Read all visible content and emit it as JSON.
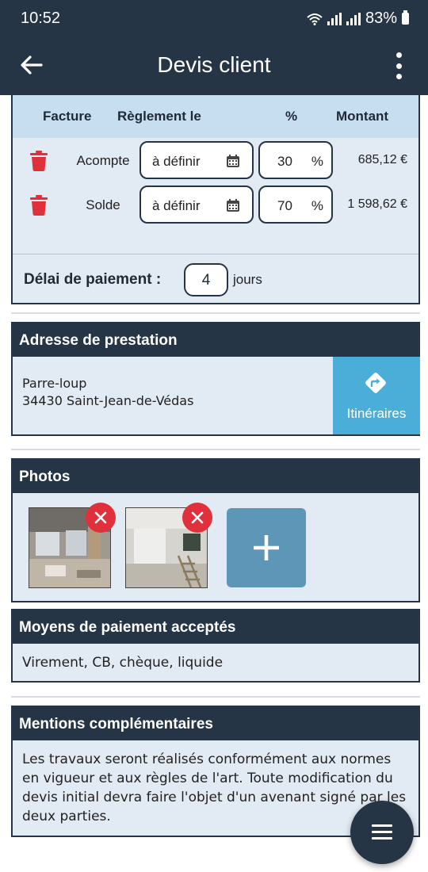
{
  "status_bar": {
    "time": "10:52",
    "battery": "83%"
  },
  "app_bar": {
    "title": "Devis client"
  },
  "payment_schedule": {
    "headers": {
      "invoice": "Facture",
      "settlement": "Règlement le",
      "percent": "%",
      "amount": "Montant"
    },
    "rows": [
      {
        "label": "Acompte",
        "date": "à définir",
        "percent": "30",
        "percent_sign": "%",
        "amount": "685,12 €"
      },
      {
        "label": "Solde",
        "date": "à définir",
        "percent": "70",
        "percent_sign": "%",
        "amount": "1 598,62 €"
      }
    ],
    "delay_label": "Délai de paiement :",
    "delay_value": "4",
    "delay_unit": "jours"
  },
  "address": {
    "title": "Adresse de prestation",
    "line1": "Parre-loup",
    "line2": "34430 Saint-Jean-de-Védas",
    "itinerary_label": "Itinéraires"
  },
  "photos": {
    "title": "Photos"
  },
  "payment_methods": {
    "title": "Moyens de paiement acceptés",
    "text": "Virement, CB, chèque, liquide"
  },
  "mentions": {
    "title": "Mentions complémentaires",
    "text": "Les travaux seront réalisés conformément aux normes en vigueur et aux règles de l'art. Toute modification du devis initial devra faire l'objet d'un avenant signé par les deux parties."
  },
  "colors": {
    "header": "#253546",
    "panel": "#e2eaf3",
    "table_head": "#c6def0",
    "delete": "#e0303c",
    "itinerary": "#4aaed9",
    "add_photo": "#5d96b7"
  }
}
